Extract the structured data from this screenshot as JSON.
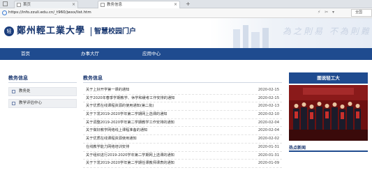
{
  "browser": {
    "tabs": [
      {
        "label": "首页"
      },
      {
        "label": "教务信息"
      }
    ],
    "new_tab": "+",
    "url": "https://info.zzuli.edu.cn/_t960/jwxx/list.htm",
    "search_label": "全国"
  },
  "header": {
    "school_name": "鄭州輕工業大學",
    "portal_name": "智慧校园门户",
    "motto": "為之則易 不為則難",
    "logo_glyph": "轻"
  },
  "nav": {
    "items": [
      {
        "label": "首页"
      },
      {
        "label": "办事大厅"
      },
      {
        "label": "应用中心"
      }
    ]
  },
  "sidebar": {
    "title": "教务信息",
    "items": [
      {
        "label": "教务处"
      },
      {
        "label": "教学评估中心"
      }
    ]
  },
  "main": {
    "title": "教务信息",
    "rows": [
      {
        "title": "关于上好开学第一课的通知",
        "date": "2020-02-15"
      },
      {
        "title": "关于2020年春季学期教学、休学和缓考工作安排的通知",
        "date": "2020-02-15"
      },
      {
        "title": "关于优质在线课程资源的使用通知(第二批)",
        "date": "2020-02-13"
      },
      {
        "title": "关于下发2019-2020学年第二学期网上选课的通知",
        "date": "2020-02-10"
      },
      {
        "title": "关于调整2019-2020学年第二学期教学工作安排的通知",
        "date": "2020-02-04"
      },
      {
        "title": "关于做好教学网络线上课程准备的通知",
        "date": "2020-02-04"
      },
      {
        "title": "关于优质在线课程资源使用通知",
        "date": "2020-02-02"
      },
      {
        "title": "在线教学能力网络培训安排",
        "date": "2020-01-31"
      },
      {
        "title": "关于组织进行2019-2020学年第二学期网上选课的通知",
        "date": "2020-01-31"
      },
      {
        "title": "关于下发2019-2020学年第二学期任课教师课表的通知",
        "date": "2020-01-09"
      }
    ]
  },
  "right": {
    "header": "图说轻工大",
    "hot_news_title": "热点新闻"
  },
  "colors": {
    "brand_blue": "#1f4b8f",
    "dark_blue": "#16356e",
    "photo_red": "#7a1212"
  }
}
